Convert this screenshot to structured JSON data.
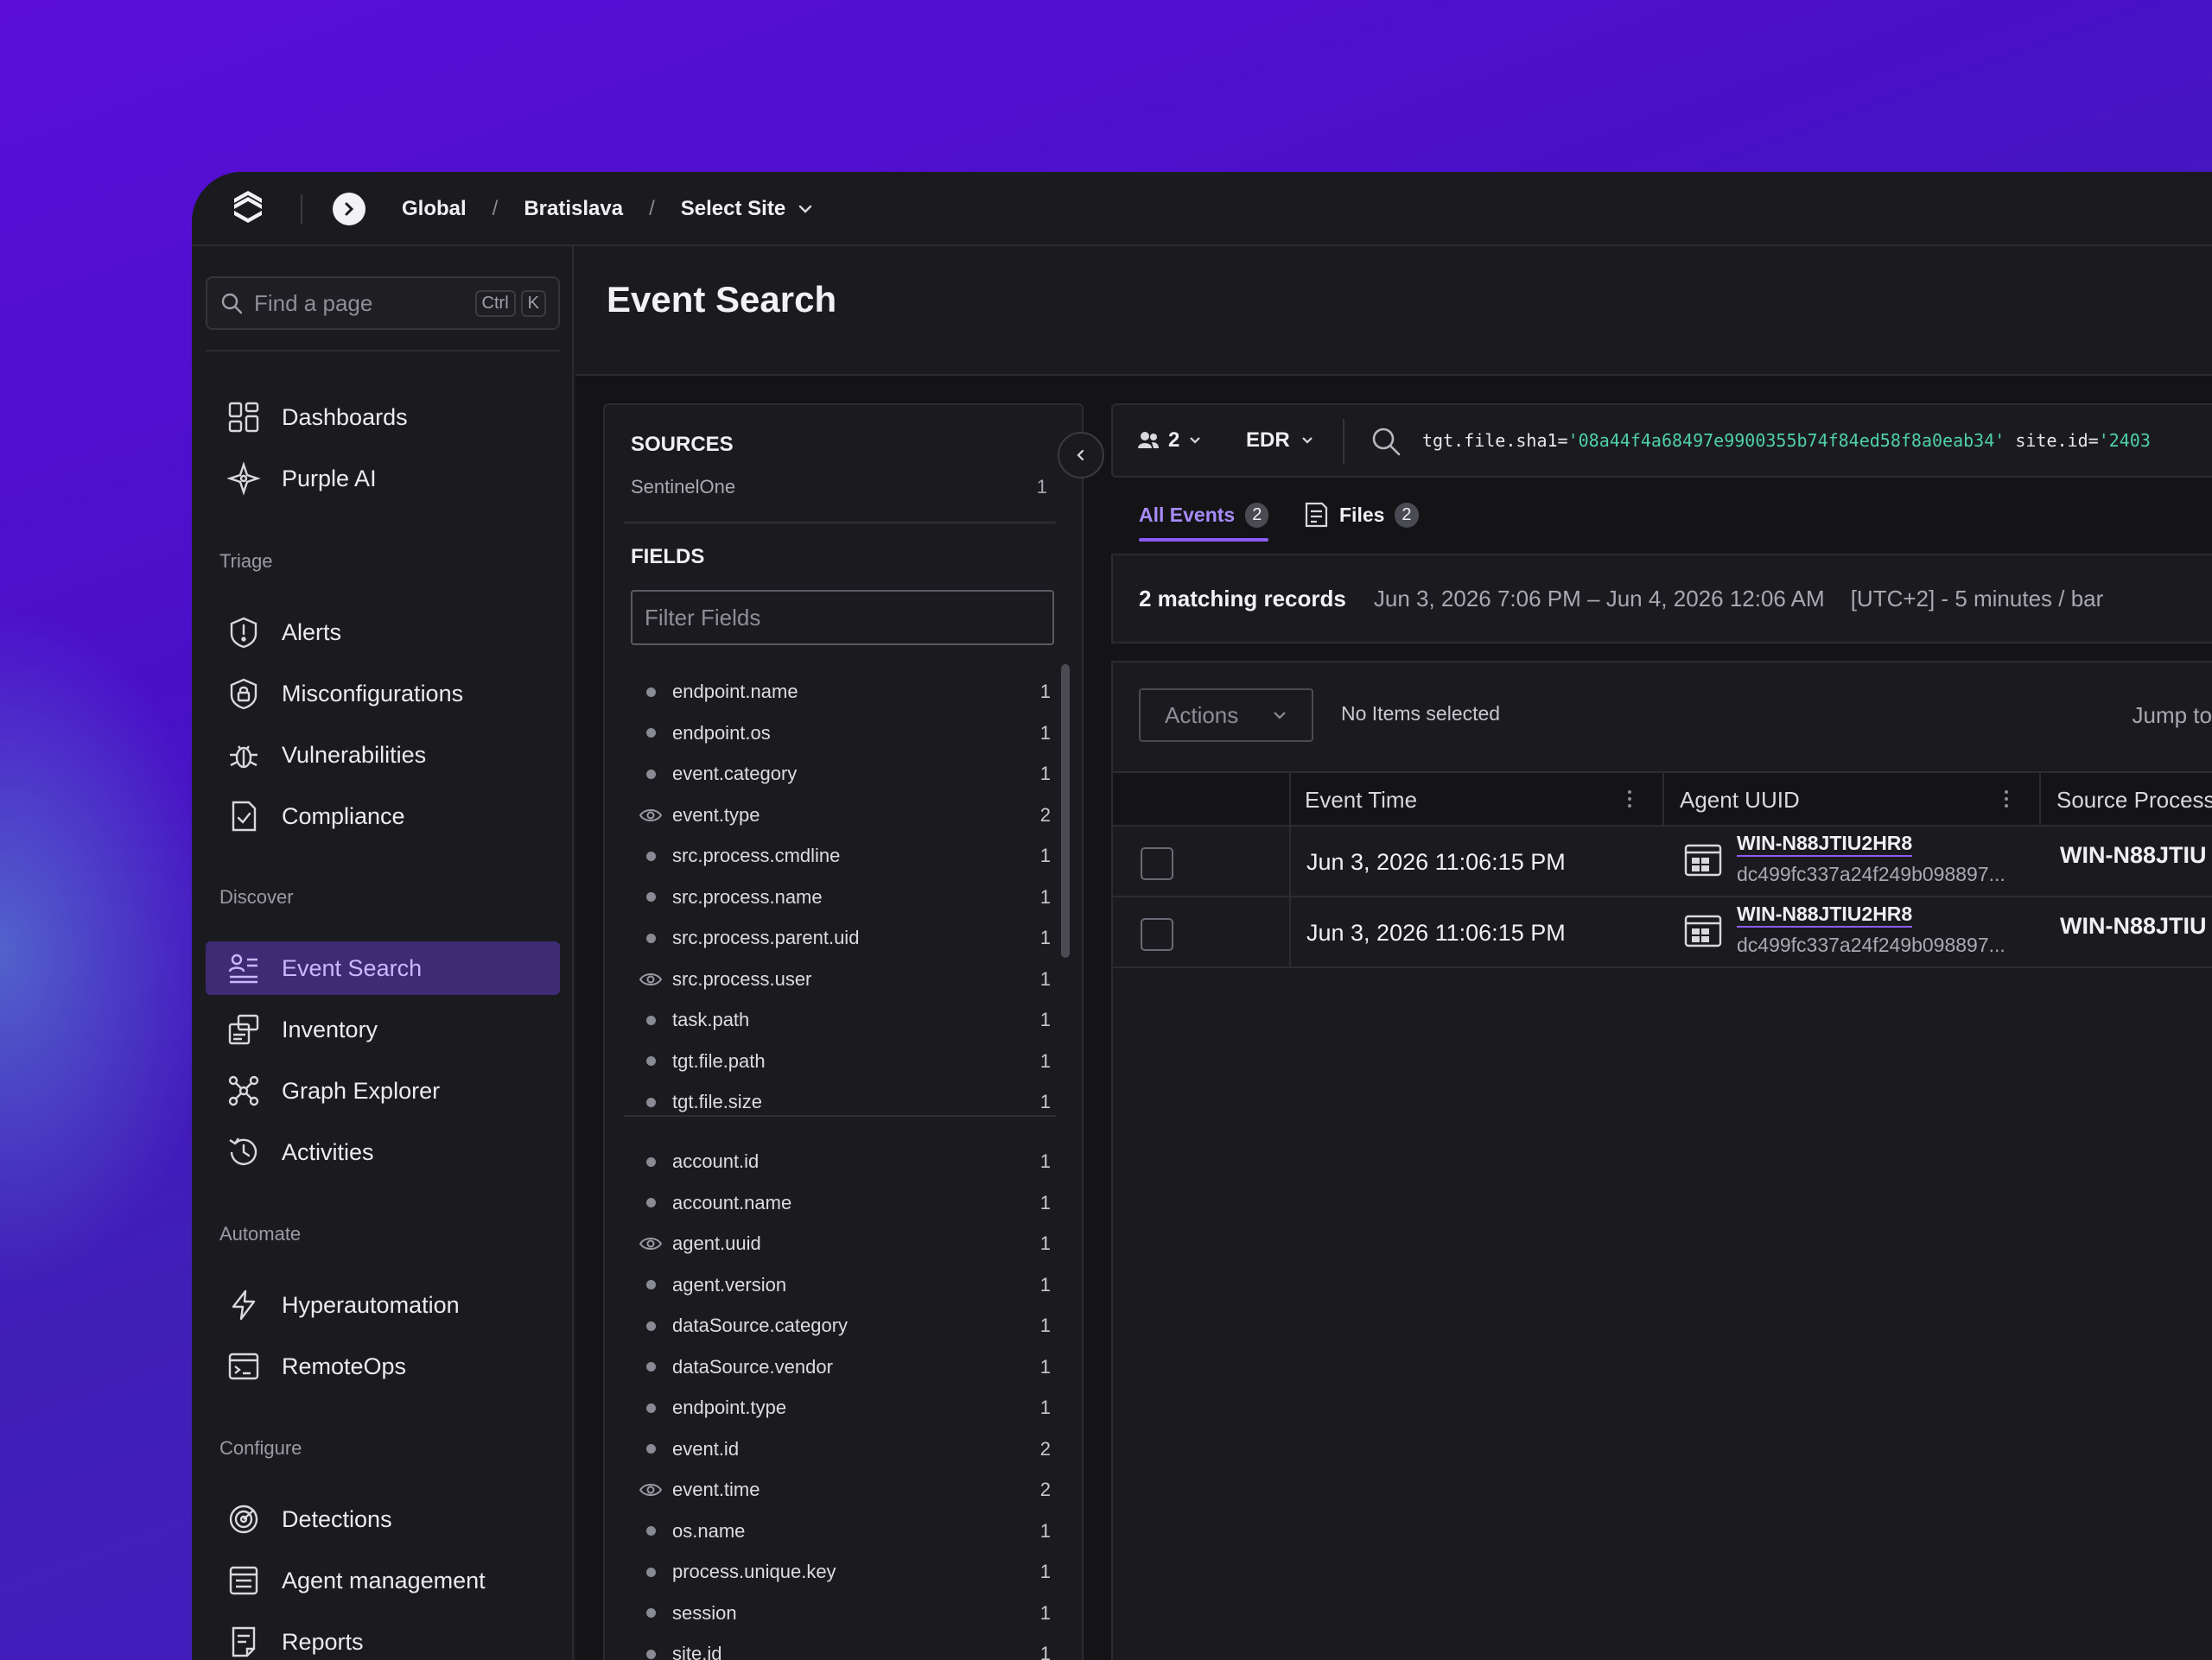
{
  "breadcrumb": {
    "global": "Global",
    "sep1": "/",
    "region": "Bratislava",
    "sep2": "/",
    "site": "Select Site"
  },
  "sidebar": {
    "search_placeholder": "Find a page",
    "shortcut_ctrl": "Ctrl",
    "shortcut_k": "K",
    "top_items": [
      {
        "label": "Dashboards",
        "icon": "dashboard-icon"
      },
      {
        "label": "Purple AI",
        "icon": "purple-ai-icon"
      }
    ],
    "sections": [
      {
        "title": "Triage",
        "items": [
          {
            "label": "Alerts"
          },
          {
            "label": "Misconfigurations"
          },
          {
            "label": "Vulnerabilities"
          },
          {
            "label": "Compliance"
          }
        ]
      },
      {
        "title": "Discover",
        "items": [
          {
            "label": "Event Search",
            "active": true
          },
          {
            "label": "Inventory"
          },
          {
            "label": "Graph Explorer"
          },
          {
            "label": "Activities"
          }
        ]
      },
      {
        "title": "Automate",
        "items": [
          {
            "label": "Hyperautomation"
          },
          {
            "label": "RemoteOps"
          }
        ]
      },
      {
        "title": "Configure",
        "items": [
          {
            "label": "Detections"
          },
          {
            "label": "Agent management"
          },
          {
            "label": "Reports"
          }
        ]
      }
    ]
  },
  "page_title": "Event Search",
  "fields_panel": {
    "sources_title": "SOURCES",
    "source_name": "SentinelOne",
    "source_count": "1",
    "fields_title": "FIELDS",
    "filter_placeholder": "Filter Fields",
    "group1": [
      {
        "name": "endpoint.name",
        "count": "1",
        "eye": false
      },
      {
        "name": "endpoint.os",
        "count": "1",
        "eye": false
      },
      {
        "name": "event.category",
        "count": "1",
        "eye": false
      },
      {
        "name": "event.type",
        "count": "2",
        "eye": true
      },
      {
        "name": "src.process.cmdline",
        "count": "1",
        "eye": false
      },
      {
        "name": "src.process.name",
        "count": "1",
        "eye": false
      },
      {
        "name": "src.process.parent.uid",
        "count": "1",
        "eye": false
      },
      {
        "name": "src.process.user",
        "count": "1",
        "eye": true
      },
      {
        "name": "task.path",
        "count": "1",
        "eye": false
      },
      {
        "name": "tgt.file.path",
        "count": "1",
        "eye": false
      },
      {
        "name": "tgt.file.size",
        "count": "1",
        "eye": false
      }
    ],
    "group2": [
      {
        "name": "account.id",
        "count": "1",
        "eye": false
      },
      {
        "name": "account.name",
        "count": "1",
        "eye": false
      },
      {
        "name": "agent.uuid",
        "count": "1",
        "eye": true
      },
      {
        "name": "agent.version",
        "count": "1",
        "eye": false
      },
      {
        "name": "dataSource.category",
        "count": "1",
        "eye": false
      },
      {
        "name": "dataSource.vendor",
        "count": "1",
        "eye": false
      },
      {
        "name": "endpoint.type",
        "count": "1",
        "eye": false
      },
      {
        "name": "event.id",
        "count": "2",
        "eye": false
      },
      {
        "name": "event.time",
        "count": "2",
        "eye": true
      },
      {
        "name": "os.name",
        "count": "1",
        "eye": false
      },
      {
        "name": "process.unique.key",
        "count": "1",
        "eye": false
      },
      {
        "name": "session",
        "count": "1",
        "eye": false
      },
      {
        "name": "site.id",
        "count": "1",
        "eye": false
      }
    ]
  },
  "query_bar": {
    "users_count": "2",
    "source": "EDR",
    "q_key1": "tgt.file.sha1=",
    "q_val1": "'08a44f4a68497e9900355b74f84ed58f8a0eab34'",
    "q_key2": " site.id=",
    "q_val2": "'2403"
  },
  "tabs": [
    {
      "label": "All Events",
      "count": "2"
    },
    {
      "label": "Files",
      "count": "2"
    }
  ],
  "summary": {
    "matching": "2 matching records",
    "range": "Jun 3, 2026 7:06 PM – Jun 4, 2026 12:06 AM",
    "tz": "[UTC+2] - 5 minutes / bar"
  },
  "grid": {
    "actions_label": "Actions",
    "no_items": "No Items selected",
    "jump_to": "Jump to",
    "columns": [
      "Event Time",
      "Agent UUID",
      "Source Process"
    ],
    "rows": [
      {
        "time": "Jun 3, 2026 11:06:15 PM",
        "agent_name": "WIN-N88JTIU2HR8",
        "agent_uuid": "dc499fc337a24f249b098897...",
        "source_process": "WIN-N88JTIU"
      },
      {
        "time": "Jun 3, 2026 11:06:15 PM",
        "agent_name": "WIN-N88JTIU2HR8",
        "agent_uuid": "dc499fc337a24f249b098897...",
        "source_process": "WIN-N88JTIU"
      }
    ]
  },
  "colors": {
    "accent": "#8b5cf6",
    "active_bg": "#3d2c75",
    "query_string": "#4fd1a5"
  }
}
